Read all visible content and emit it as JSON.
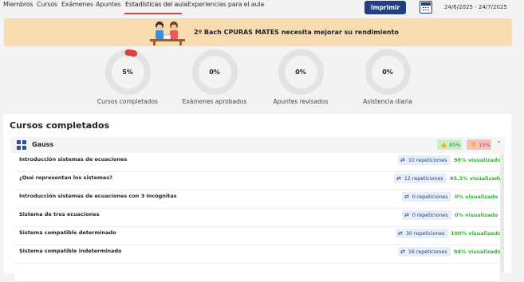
{
  "nav": {
    "tabs": [
      {
        "label": "Miembros"
      },
      {
        "label": "Cursos"
      },
      {
        "label": "Exámenes"
      },
      {
        "label": "Apuntes"
      },
      {
        "label": "Estadísticas del aula"
      },
      {
        "label": "Experiencias para el aula"
      }
    ],
    "active_tab": "Estadísticas del aula",
    "print_label": "Imprimir",
    "date_range": "24/6/2025 - 24/7/2025"
  },
  "banner": {
    "message": "2º Bach CPURAS MATES necesita mejorar su rendimiento"
  },
  "stats": [
    {
      "value": "5%",
      "label": "Cursos completados",
      "fraction": 0.05
    },
    {
      "value": "0%",
      "label": "Exámenes aprobados",
      "fraction": 0
    },
    {
      "value": "0%",
      "label": "Apuntes revisados",
      "fraction": 0
    },
    {
      "value": "0%",
      "label": "Asistencia diaria",
      "fraction": 0
    }
  ],
  "colors": {
    "accent": "#1f3f86",
    "ring_track": "#e3e3e3",
    "ring_progress": "#dc4040",
    "banner_bg": "#f8dcb1",
    "positive": "#35b035",
    "negative": "#c23a3a"
  },
  "courses": {
    "title": "Cursos completados",
    "course": {
      "name": "Gauss",
      "like": "85%",
      "dislike": "15%"
    },
    "lessons": [
      {
        "title": "Introducción sistemas de ecuaciones",
        "repetitions": "10 repeticiones",
        "viewed": "98% visualizado"
      },
      {
        "title": "¿Qué representan los sistemas?",
        "repetitions": "12 repeticiones",
        "viewed": "65.3% visualizado"
      },
      {
        "title": "Introducción sistemas de ecuaciones con 3 incógnitas",
        "repetitions": "0 repeticiones",
        "viewed": "0% visualizado"
      },
      {
        "title": "Sistema de tres ecuaciones",
        "repetitions": "0 repeticiones",
        "viewed": "0% visualizado"
      },
      {
        "title": "Sistema compatible determinado",
        "repetitions": "30 repeticiones",
        "viewed": "100% visualizado"
      },
      {
        "title": "Sistema compatible indeterminado",
        "repetitions": "16 repeticiones",
        "viewed": "94% visualizado"
      },
      {
        "title": "",
        "repetitions": "",
        "viewed": ""
      }
    ]
  }
}
